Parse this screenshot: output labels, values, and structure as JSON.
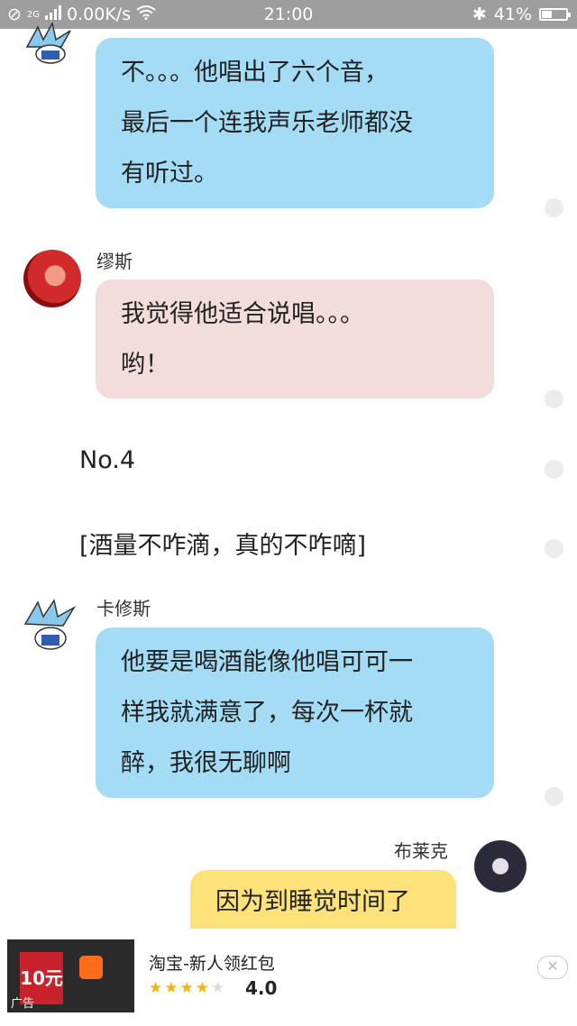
{
  "status_bar": {
    "network_label": "2G",
    "speed": "0.00K/s",
    "time": "21:00",
    "battery_percent": "41%",
    "battery_level": 0.41
  },
  "messages": [
    {
      "type": "bubble",
      "sender": "",
      "color": "blue",
      "align": "left",
      "avatar": "winged-chibi",
      "lines": [
        "不。。。他唱出了六个音，",
        "最后一个连我声乐老师都没",
        "有听过。"
      ]
    },
    {
      "type": "bubble",
      "sender": "缪斯",
      "color": "pink",
      "align": "left",
      "avatar": "red-hair",
      "lines": [
        "我觉得他适合说唱。。。",
        "哟！"
      ]
    },
    {
      "type": "narration",
      "text": "No.4"
    },
    {
      "type": "narration",
      "text": "[酒量不咋滴，真的不咋嘀]"
    },
    {
      "type": "bubble",
      "sender": "卡修斯",
      "color": "blue",
      "align": "left",
      "avatar": "winged-chibi",
      "lines": [
        "他要是喝酒能像他唱可可一",
        "样我就满意了，每次一杯就",
        "醉，我很无聊啊"
      ]
    },
    {
      "type": "bubble",
      "sender": "布莱克",
      "color": "yellow",
      "align": "right",
      "avatar": "dark-hair",
      "lines": [
        "因为到睡觉时间了"
      ]
    }
  ],
  "ad": {
    "title": "淘宝-新人领红包",
    "rating": "4.0",
    "stars": 4,
    "thumb_amount": "10元",
    "ad_label": "广告",
    "close_icon": "close-icon"
  },
  "colors": {
    "blue_bubble": "#a5dcf5",
    "pink_bubble": "#f2dcdc",
    "yellow_bubble": "#fde27a",
    "status_bar": "#9e9e9e"
  }
}
